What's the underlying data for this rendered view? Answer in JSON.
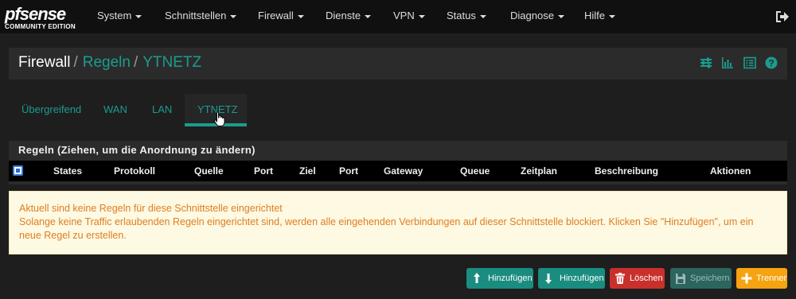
{
  "brand": {
    "logo_text": "pfsense",
    "edition": "COMMUNITY EDITION"
  },
  "nav": {
    "items": [
      {
        "label": "System"
      },
      {
        "label": "Schnittstellen"
      },
      {
        "label": "Firewall"
      },
      {
        "label": "Dienste"
      },
      {
        "label": "VPN"
      },
      {
        "label": "Status"
      },
      {
        "label": "Diagnose"
      },
      {
        "label": "Hilfe"
      }
    ],
    "logout_icon": "logout-icon"
  },
  "breadcrumb": {
    "first": "Firewall",
    "separator": "/",
    "second": "Regeln",
    "third": "YTNETZ"
  },
  "header_icons": [
    "sliders-icon",
    "bar-chart-icon",
    "list-icon",
    "help-icon"
  ],
  "tabs": [
    {
      "label": "Übergreifend"
    },
    {
      "label": "WAN"
    },
    {
      "label": "LAN"
    },
    {
      "label": "YTNETZ",
      "active": true
    }
  ],
  "rules_panel": {
    "title": "Regeln (Ziehen, um die Anordnung zu ändern)",
    "columns": [
      "States",
      "Protokoll",
      "Quelle",
      "Port",
      "Ziel",
      "Port",
      "Gateway",
      "Queue",
      "Zeitplan",
      "Beschreibung",
      "Aktionen"
    ]
  },
  "alert": {
    "line1": "Aktuell sind keine Regeln für diese Schnittstelle eingerichtet",
    "line2": "Solange keine Traffic erlaubenden Regeln eingerichtet sind, werden alle eingehenden Verbindungen auf dieser Schnittstelle blockiert. Klicken Sie \"Hinzufügen\", um ein neue Regel zu erstellen."
  },
  "buttons": {
    "add_top": "Hinzufügen",
    "add_bottom": "Hinzufügen",
    "delete": "Löschen",
    "save": "Speichern",
    "separator": "Trenner"
  },
  "colors": {
    "accent": "#1b9c8e",
    "navbar": "#101010",
    "panel": "#2b2b2b",
    "alert_bg": "#fdf9e2",
    "alert_text": "#e07e22",
    "danger": "#c9302c",
    "warning": "#f5a310"
  }
}
